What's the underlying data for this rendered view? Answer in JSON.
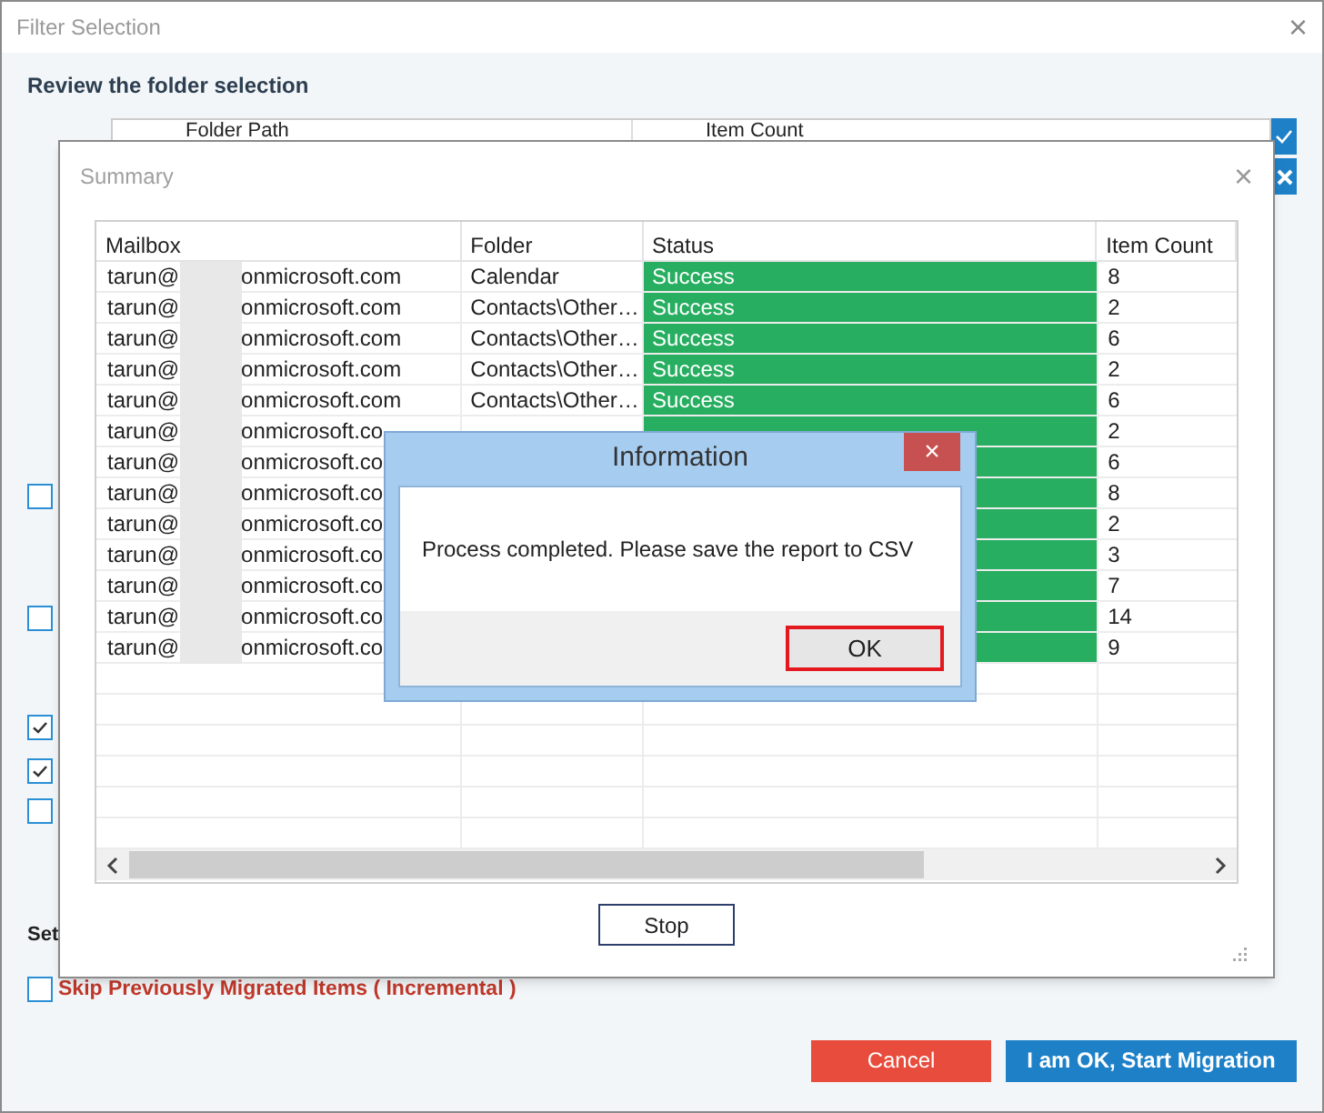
{
  "window": {
    "title": "Filter Selection",
    "close": "×"
  },
  "heading": "Review the folder selection",
  "folder_table": {
    "columns": [
      "Folder Path",
      "Item Count"
    ]
  },
  "options": [
    {
      "checked": false
    },
    {
      "checked": false
    },
    {
      "checked": true
    },
    {
      "checked": true
    },
    {
      "checked": false
    }
  ],
  "settings_heading": "Set",
  "incremental": {
    "label": "Skip Previously Migrated Items ( Incremental )",
    "checked": false
  },
  "buttons": [
    {
      "label": "Cancel",
      "kind": "cancel"
    },
    {
      "label": "I am OK, Start Migration",
      "kind": "primary"
    }
  ],
  "summary": {
    "title": "Summary",
    "close": "×",
    "columns": [
      "Mailbox",
      "Folder",
      "Status",
      "Item Count"
    ],
    "rows": [
      {
        "user": "tarun@",
        "domain": "onmicrosoft.com",
        "folder": "Calendar",
        "status": "Success",
        "kind": "success",
        "count": "8"
      },
      {
        "user": "tarun@",
        "domain": "onmicrosoft.com",
        "folder": "Contacts\\Other…",
        "status": "Success",
        "kind": "success",
        "count": "2"
      },
      {
        "user": "tarun@",
        "domain": "onmicrosoft.com",
        "folder": "Contacts\\Other…",
        "status": "Success",
        "kind": "success",
        "count": "6"
      },
      {
        "user": "tarun@",
        "domain": "onmicrosoft.com",
        "folder": "Contacts\\Other…",
        "status": "Success",
        "kind": "success",
        "count": "2"
      },
      {
        "user": "tarun@",
        "domain": "onmicrosoft.com",
        "folder": "Contacts\\Other…",
        "status": "Success",
        "kind": "success",
        "count": "6"
      },
      {
        "user": "tarun@",
        "domain": "onmicrosoft.co",
        "kind": "success",
        "count": "2"
      },
      {
        "user": "tarun@",
        "domain": "onmicrosoft.co",
        "kind": "success",
        "count": "6"
      },
      {
        "user": "tarun@",
        "domain": "onmicrosoft.co",
        "kind": "success",
        "count": "8"
      },
      {
        "user": "tarun@",
        "domain": "onmicrosoft.co",
        "kind": "success",
        "count": "2"
      },
      {
        "user": "tarun@",
        "domain": "onmicrosoft.co",
        "kind": "success",
        "count": "3"
      },
      {
        "user": "tarun@",
        "domain": "onmicrosoft.co",
        "kind": "success",
        "count": "7"
      },
      {
        "user": "tarun@",
        "domain": "onmicrosoft.co",
        "kind": "success",
        "count": "14"
      },
      {
        "user": "tarun@",
        "domain": "onmicrosoft.co",
        "kind": "success",
        "count": "9"
      }
    ],
    "stop": "Stop"
  },
  "dialog": {
    "title": "Information",
    "close": "×",
    "message": "Process completed. Please save the report to CSV",
    "ok": "OK"
  }
}
